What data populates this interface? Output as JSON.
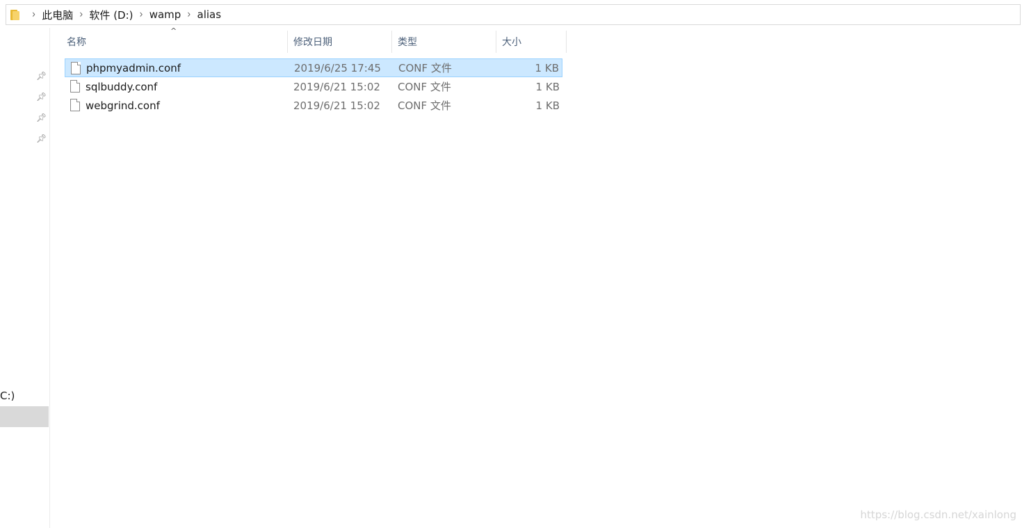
{
  "breadcrumb": {
    "items": [
      "此电脑",
      "软件 (D:)",
      "wamp",
      "alias"
    ],
    "separator": "›"
  },
  "columns": {
    "name": "名称",
    "date": "修改日期",
    "type": "类型",
    "size": "大小",
    "sort_indicator": "^"
  },
  "files": [
    {
      "name": "phpmyadmin.conf",
      "date": "2019/6/25 17:45",
      "type": "CONF 文件",
      "size": "1 KB",
      "selected": true
    },
    {
      "name": "sqlbuddy.conf",
      "date": "2019/6/21 15:02",
      "type": "CONF 文件",
      "size": "1 KB",
      "selected": false
    },
    {
      "name": "webgrind.conf",
      "date": "2019/6/21 15:02",
      "type": "CONF 文件",
      "size": "1 KB",
      "selected": false
    }
  ],
  "nav_pane": {
    "drive_label": "C:)",
    "pin_icon": "pin-icon"
  },
  "watermark": "https://blog.csdn.net/xainlong",
  "colors": {
    "selection_bg": "#cce8ff",
    "selection_border": "#99d1ff",
    "header_text": "#4c607a",
    "folder_icon": "#f7d36b"
  }
}
